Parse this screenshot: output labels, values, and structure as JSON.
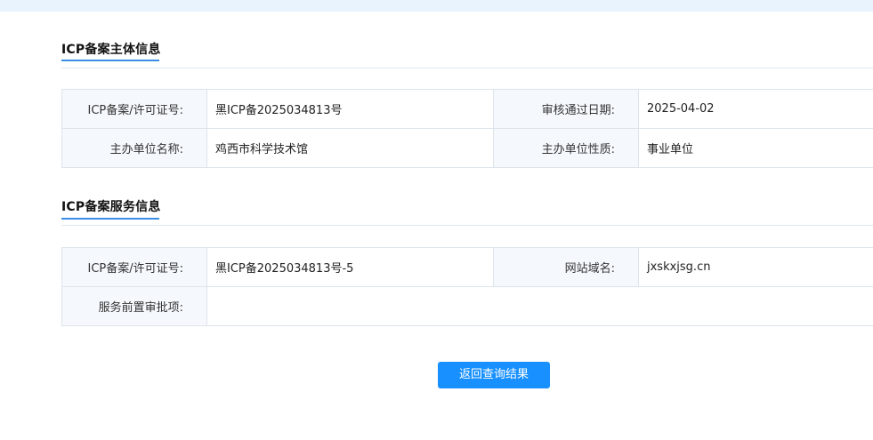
{
  "sections": [
    {
      "title": "ICP备案主体信息",
      "rows": [
        [
          {
            "label": "ICP备案/许可证号:",
            "value": "黑ICP备2025034813号"
          },
          {
            "label": "审核通过日期:",
            "value": "2025-04-02"
          }
        ],
        [
          {
            "label": "主办单位名称:",
            "value": "鸡西市科学技术馆"
          },
          {
            "label": "主办单位性质:",
            "value": "事业单位"
          }
        ]
      ]
    },
    {
      "title": "ICP备案服务信息",
      "rows": [
        [
          {
            "label": "ICP备案/许可证号:",
            "value": "黑ICP备2025034813号-5"
          },
          {
            "label": "网站域名:",
            "value": "jxskxjsg.cn"
          }
        ],
        [
          {
            "label": "服务前置审批项:",
            "value": ""
          }
        ]
      ]
    }
  ],
  "actions": {
    "back_label": "返回查询结果"
  },
  "colors": {
    "accent": "#1890ff",
    "header_band": "#e8f3fe",
    "label_cell": "#f5f9fd",
    "border": "#dde4ec"
  }
}
